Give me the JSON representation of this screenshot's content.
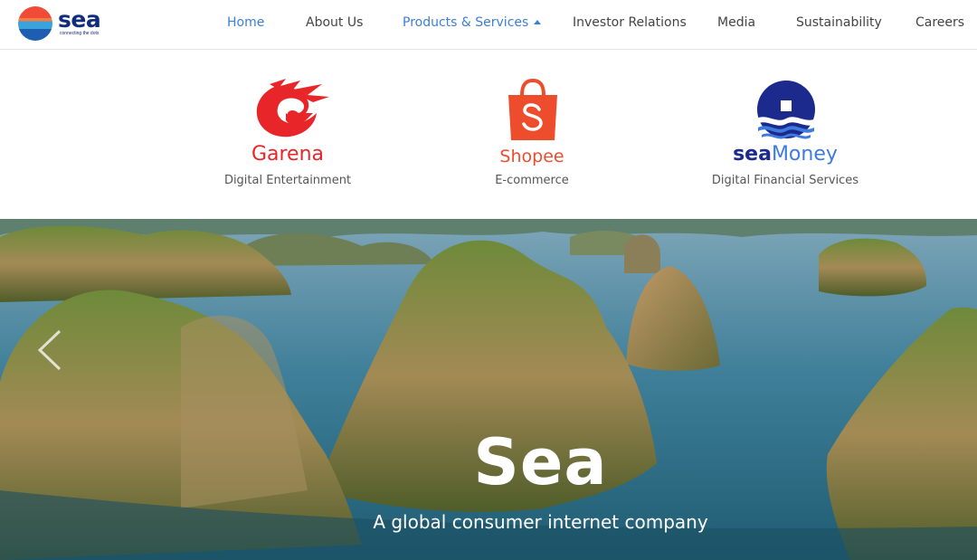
{
  "header": {
    "logo": {
      "name": "sea",
      "tagline": "connecting the dots"
    },
    "nav": [
      {
        "label": "Home"
      },
      {
        "label": "About Us"
      },
      {
        "label": "Products & Services"
      },
      {
        "label": "Investor Relations"
      },
      {
        "label": "Media"
      },
      {
        "label": "Sustainability"
      },
      {
        "label": "Careers"
      }
    ],
    "active_color": "#3b7fd6"
  },
  "products": [
    {
      "brand": "Garena",
      "description": "Digital Entertainment",
      "color": "#e8262a"
    },
    {
      "brand": "Shopee",
      "description": "E-commerce",
      "color": "#ee4d2d"
    },
    {
      "brand_part1": "sea",
      "brand_part2": "Money",
      "description": "Digital Financial Services",
      "color": "#1b2a8c"
    }
  ],
  "hero": {
    "title": "Sea",
    "subtitle": "A global consumer internet company",
    "prev_icon": "chevron-left-icon"
  }
}
